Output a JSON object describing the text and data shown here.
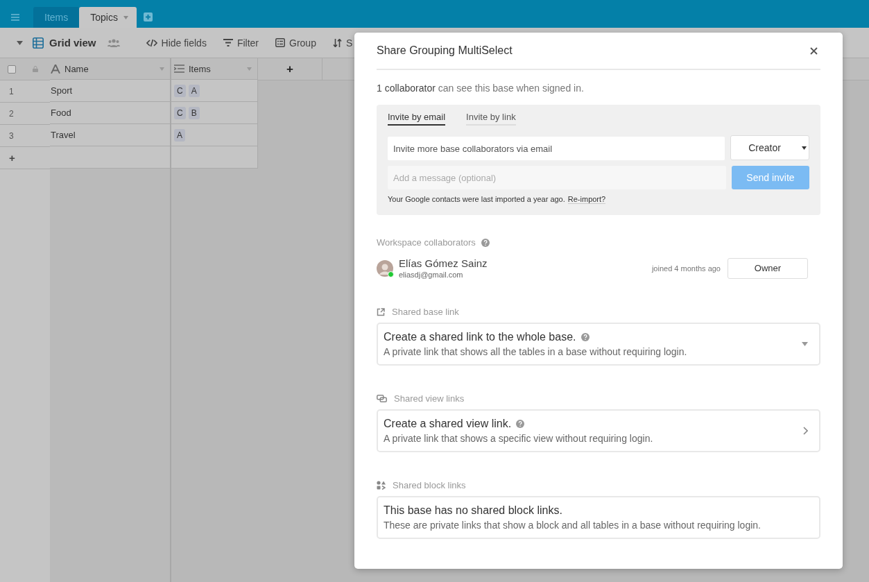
{
  "topbar": {
    "tabs": [
      {
        "label": "Items",
        "selected": false
      },
      {
        "label": "Topics",
        "selected": true
      }
    ]
  },
  "toolbar": {
    "view_name": "Grid view",
    "buttons": [
      {
        "kind": "hide",
        "label": "Hide fields"
      },
      {
        "kind": "filter",
        "label": "Filter"
      },
      {
        "kind": "group",
        "label": "Group"
      },
      {
        "kind": "sort",
        "label": "S"
      }
    ]
  },
  "grid": {
    "select_all_checked": false,
    "columns": [
      {
        "kind": "text",
        "label": "Name"
      },
      {
        "kind": "multi",
        "label": "Items"
      }
    ],
    "add_column": "+",
    "rows": [
      {
        "number": "1",
        "name": "Sport",
        "items": [
          "C",
          "A"
        ]
      },
      {
        "number": "2",
        "name": "Food",
        "items": [
          "C",
          "B"
        ]
      },
      {
        "number": "3",
        "name": "Travel",
        "items": [
          "A"
        ]
      }
    ],
    "add_row": "+"
  },
  "modal": {
    "title": "Share Grouping MultiSelect",
    "summary": "**1 collaborator** can see this base when signed in.",
    "invite": {
      "tabs": [
        {
          "label": "Invite by email",
          "selected": true
        },
        {
          "label": "Invite by link",
          "selected": false
        }
      ],
      "email_placeholder": "Invite more base collaborators via email",
      "role": "Creator",
      "message_placeholder": "Add a message (optional)",
      "send_button": {
        "label": "Send invite",
        "disabled": true
      },
      "contacts_note": "Your Google contacts were last imported a year ago.",
      "reimport_link": "Re-import?"
    },
    "workspace": {
      "heading": "Workspace collaborators",
      "collaborators": [
        {
          "name": "Elías Gómez Sainz",
          "email": "eliasdj@gmail.com",
          "joined": "joined 4 months ago",
          "role": "Owner",
          "online": true
        }
      ]
    },
    "sections": [
      {
        "kind": "base",
        "heading": "Shared base link",
        "title": "Create a shared link to the whole base.",
        "help": true,
        "description": "A private link that shows all the tables in a base without requiring login."
      },
      {
        "kind": "view",
        "heading": "Shared view links",
        "title": "Create a shared view link.",
        "help": true,
        "description": "A private link that shows a specific view without requiring login."
      },
      {
        "kind": "block",
        "heading": "Shared block links",
        "title": "This base has no shared block links.",
        "help": false,
        "description": "These are private links that show a block and all tables in a base without requiring login."
      }
    ]
  }
}
